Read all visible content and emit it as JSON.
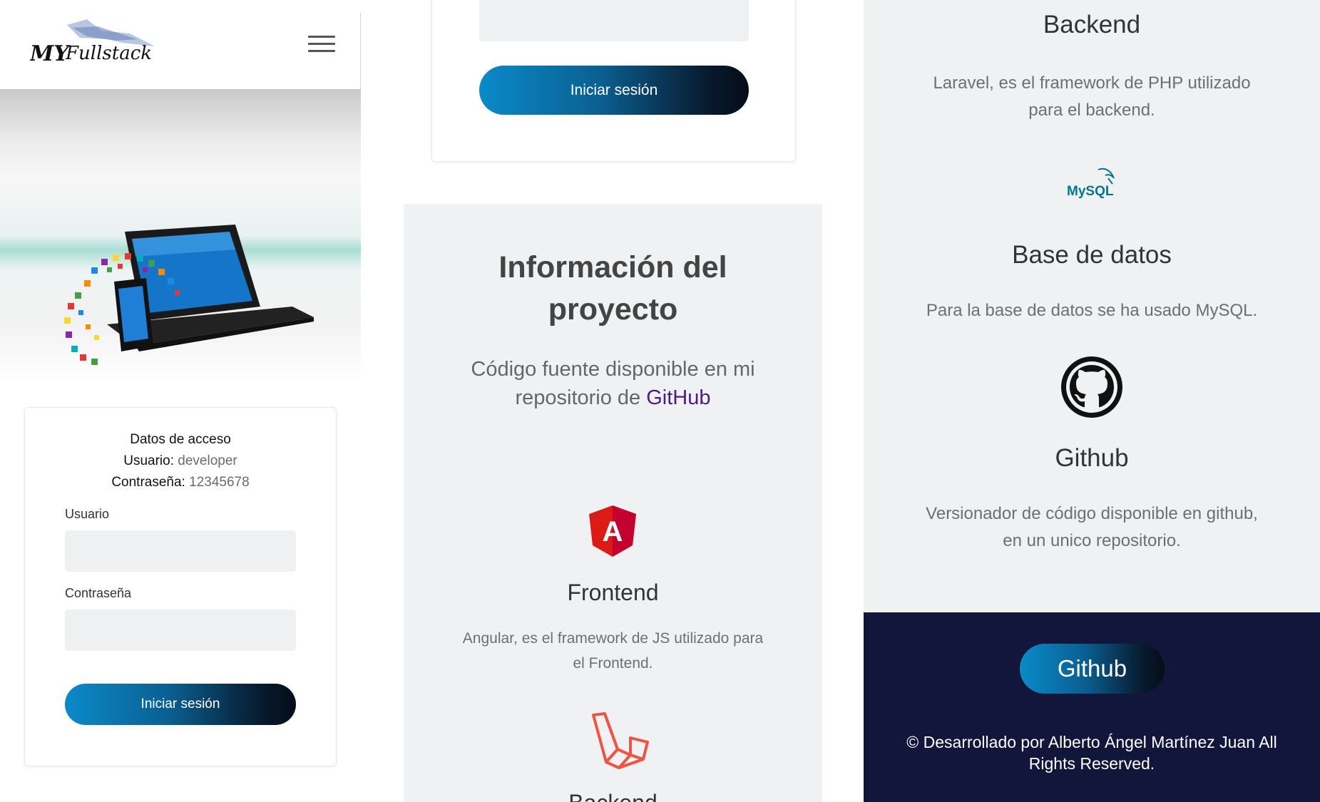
{
  "panel1": {
    "logo_text": "MY Fullstack",
    "login": {
      "heading": "Datos de acceso",
      "user_label": "Usuario:",
      "user_value": "developer",
      "pass_label": "Contraseña:",
      "pass_value": "12345678",
      "field_user_label": "Usuario",
      "field_pass_label": "Contraseña",
      "submit_label": "Iniciar sesión"
    }
  },
  "panel2": {
    "submit_label": "Iniciar sesión",
    "info": {
      "title_line1": "Información del",
      "title_line2": "proyecto",
      "subtitle_line1": "Código fuente disponible en mi",
      "subtitle_prefix": "repositorio de ",
      "subtitle_link": "GitHub"
    },
    "frontend": {
      "icon_text": "A",
      "title": "Frontend",
      "desc_line1": "Angular, es el framework de JS utilizado para",
      "desc_line2": "el Frontend."
    },
    "backend_partial": "Backend"
  },
  "panel3": {
    "backend": {
      "title": "Backend",
      "desc_line1": "Laravel, es el framework de PHP utilizado",
      "desc_line2": "para el backend."
    },
    "database": {
      "icon_text": "MySQL",
      "title": "Base de datos",
      "desc": "Para la base de datos se ha usado MySQL."
    },
    "github": {
      "title": "Github",
      "desc_line1": "Versionador de código disponible en github,",
      "desc_line2": "en un unico repositorio."
    },
    "footer": {
      "button_label": "Github",
      "copyright_line1": "© Desarrollado por Alberto Ángel Martínez Juan All",
      "copyright_line2": "Rights Reserved."
    }
  },
  "colors": {
    "button_gradient_start": "#0a8ac9",
    "button_gradient_end": "#050d18",
    "section_bg": "#eff1f3",
    "footer_bg": "#12163a",
    "link": "#4b1b86",
    "angular_red": "#dd1b16",
    "laravel_red": "#f05340"
  }
}
